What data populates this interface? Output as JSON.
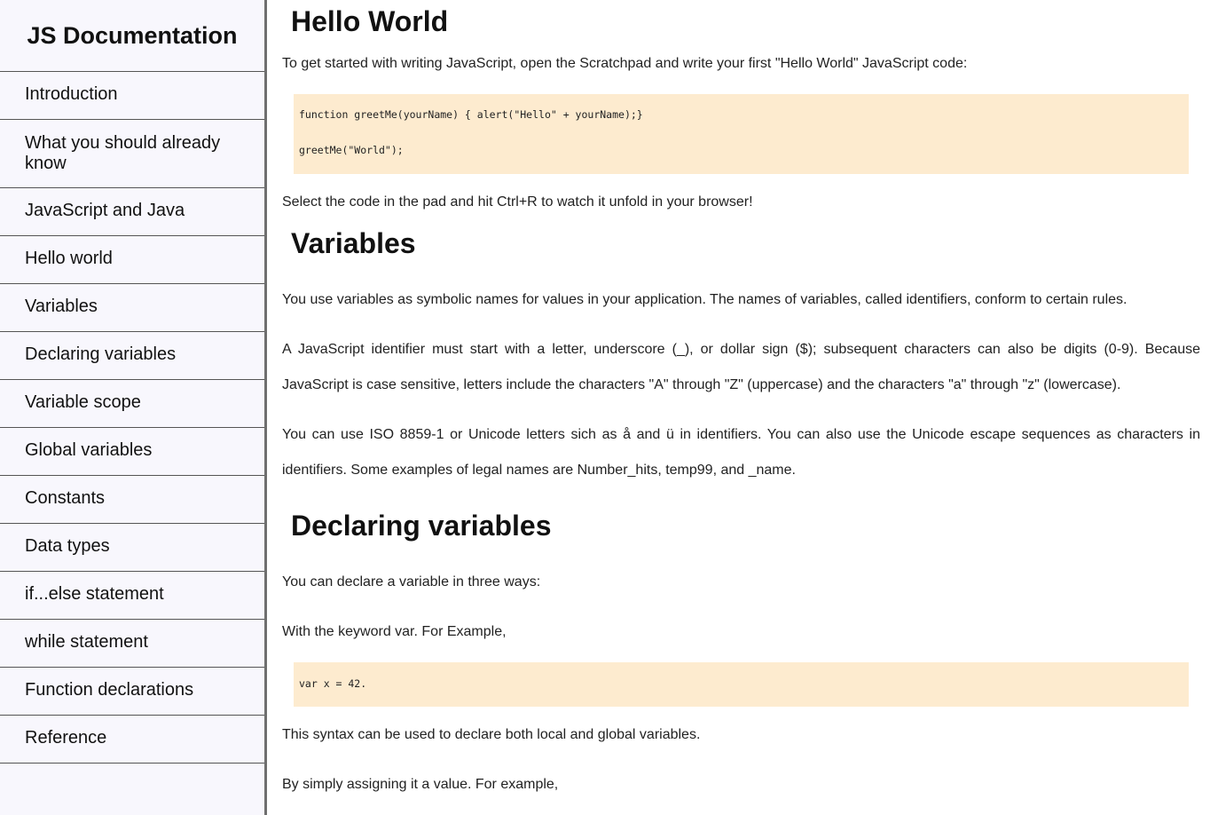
{
  "navbar": {
    "title": "JS Documentation",
    "items": [
      {
        "label": "Introduction"
      },
      {
        "label": "What you should already know"
      },
      {
        "label": "JavaScript and Java"
      },
      {
        "label": "Hello world"
      },
      {
        "label": "Variables"
      },
      {
        "label": "Declaring variables"
      },
      {
        "label": "Variable scope"
      },
      {
        "label": "Global variables"
      },
      {
        "label": "Constants"
      },
      {
        "label": "Data types"
      },
      {
        "label": "if...else statement"
      },
      {
        "label": "while statement"
      },
      {
        "label": "Function declarations"
      },
      {
        "label": "Reference"
      }
    ]
  },
  "hello_world": {
    "title": "Hello World",
    "intro": "To get started with writing JavaScript, open the Scratchpad and write your first \"Hello World\" JavaScript code:",
    "code_line1": "function greetMe(yourName) { alert(\"Hello\" + yourName);}",
    "code_line2": "greetMe(\"World\");",
    "after": "Select the code in the pad and hit Ctrl+R to watch it unfold in your browser!"
  },
  "variables": {
    "title": "Variables",
    "p1": "You use variables as symbolic names for values in your application. The names of variables, called identifiers, conform to certain rules.",
    "p2": "A JavaScript identifier must start with a letter, underscore (_), or dollar sign ($); subsequent characters can also be digits (0-9). Because JavaScript is case sensitive, letters include the characters \"A\" through \"Z\" (uppercase) and the characters \"a\" through \"z\" (lowercase).",
    "p3": "You can use ISO 8859-1 or Unicode letters sich as å and ü in identifiers. You can also use the Unicode escape sequences as characters in identifiers. Some examples of legal names are Number_hits, temp99, and _name."
  },
  "declaring": {
    "title": "Declaring variables",
    "p1": "You can declare a variable in three ways:",
    "p2": "With the keyword var. For Example,",
    "code": "var x = 42.",
    "p3": "This syntax can be used to declare both local and global variables.",
    "p4": "By simply assigning it a value. For example,"
  },
  "colors": {
    "code_bg": "#fdebcf",
    "nav_bg": "#f8f7fd",
    "nav_border": "#6f6f6f"
  }
}
